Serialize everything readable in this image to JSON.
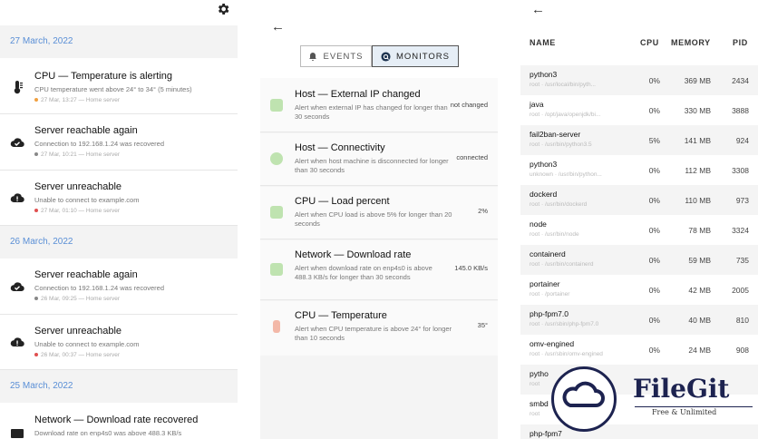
{
  "events_panel": {
    "groups": [
      {
        "date": "27 March, 2022",
        "events": [
          {
            "title": "CPU — Temperature is alerting",
            "desc": "CPU temperature went above 24° to 34° (5 minutes)",
            "meta": "27 Mar, 13:27 — Home server",
            "icon": "thermometer-icon",
            "status_color": "#f0a040"
          },
          {
            "title": "Server reachable again",
            "desc": "Connection to 192.168.1.24 was recovered",
            "meta": "27 Mar, 10:21 — Home server",
            "icon": "cloud-check-icon",
            "status_color": "#888888"
          },
          {
            "title": "Server unreachable",
            "desc": "Unable to connect to example.com",
            "meta": "27 Mar, 01:10 — Home server",
            "icon": "cloud-alert-icon",
            "status_color": "#e05050"
          }
        ]
      },
      {
        "date": "26 March, 2022",
        "events": [
          {
            "title": "Server reachable again",
            "desc": "Connection to 192.168.1.24 was recovered",
            "meta": "26 Mar, 09:25 — Home server",
            "icon": "cloud-check-icon",
            "status_color": "#888888"
          },
          {
            "title": "Server unreachable",
            "desc": "Unable to connect to example.com",
            "meta": "26 Mar, 00:37 — Home server",
            "icon": "cloud-alert-icon",
            "status_color": "#e05050"
          }
        ]
      },
      {
        "date": "25 March, 2022",
        "events": [
          {
            "title": "Network — Download rate recovered",
            "desc": "Download rate on enp4s0 was above 488.3 KB/s",
            "meta": "",
            "icon": "network-icon",
            "status_color": "#888888"
          }
        ]
      }
    ]
  },
  "monitors_panel": {
    "tabs": [
      {
        "label": "EVENTS",
        "icon": "bell-icon",
        "active": false
      },
      {
        "label": "MONITORS",
        "icon": "monitor-icon",
        "active": true
      }
    ],
    "monitors": [
      {
        "title": "Host — External IP changed",
        "desc": "Alert when external IP has changed for longer than 30 seconds",
        "value": "not changed",
        "icon": "ip-icon",
        "color": "#bfe3b0"
      },
      {
        "title": "Host — Connectivity",
        "desc": "Alert when host machine is disconnected for longer than 30 seconds",
        "value": "connected",
        "icon": "globe-icon",
        "color": "#bfe3b0"
      },
      {
        "title": "CPU — Load percent",
        "desc": "Alert when CPU load is above 5% for longer than 20 seconds",
        "value": "2%",
        "icon": "cpu-icon",
        "color": "#bfe3b0"
      },
      {
        "title": "Network — Download rate",
        "desc": "Alert when download rate on enp4s0 is above 488.3 KB/s for longer than 30 seconds",
        "value": "145.0 KB/s",
        "icon": "network-icon",
        "color": "#bfe3b0"
      },
      {
        "title": "CPU — Temperature",
        "desc": "Alert when CPU temperature is above 24° for longer than 10 seconds",
        "value": "35°",
        "icon": "thermometer-icon",
        "color": "#f3b8a8"
      }
    ]
  },
  "processes_panel": {
    "headers": {
      "name": "NAME",
      "cpu": "CPU",
      "memory": "MEMORY",
      "pid": "PID"
    },
    "rows": [
      {
        "name": "python3",
        "cmd": "root · /usr/local/bin/pyth...",
        "cpu": "0%",
        "memory": "369 MB",
        "pid": "2434"
      },
      {
        "name": "java",
        "cmd": "root · /opt/java/openjdk/bi...",
        "cpu": "0%",
        "memory": "330 MB",
        "pid": "3888"
      },
      {
        "name": "fail2ban-server",
        "cmd": "root · /usr/bin/python3.5",
        "cpu": "5%",
        "memory": "141 MB",
        "pid": "924"
      },
      {
        "name": "python3",
        "cmd": "unknown · /usr/bin/python...",
        "cpu": "0%",
        "memory": "112 MB",
        "pid": "3308"
      },
      {
        "name": "dockerd",
        "cmd": "root · /usr/bin/dockerd",
        "cpu": "0%",
        "memory": "110 MB",
        "pid": "973"
      },
      {
        "name": "node",
        "cmd": "root · /usr/bin/node",
        "cpu": "0%",
        "memory": "78 MB",
        "pid": "3324"
      },
      {
        "name": "containerd",
        "cmd": "root · /usr/bin/containerd",
        "cpu": "0%",
        "memory": "59 MB",
        "pid": "735"
      },
      {
        "name": "portainer",
        "cmd": "root · /portainer",
        "cpu": "0%",
        "memory": "42 MB",
        "pid": "2005"
      },
      {
        "name": "php-fpm7.0",
        "cmd": "root · /usr/sbin/php-fpm7.0",
        "cpu": "0%",
        "memory": "40 MB",
        "pid": "810"
      },
      {
        "name": "omv-engined",
        "cmd": "root · /usr/sbin/omv-engined",
        "cpu": "0%",
        "memory": "24 MB",
        "pid": "908"
      },
      {
        "name": "pytho",
        "cmd": "root",
        "cpu": "",
        "memory": "",
        "pid": ""
      },
      {
        "name": "smbd",
        "cmd": "root",
        "cpu": "",
        "memory": "",
        "pid": ""
      },
      {
        "name": "php-fpm7",
        "cmd": "",
        "cpu": "",
        "memory": "",
        "pid": ""
      }
    ]
  },
  "watermark": {
    "brand": "FileGit",
    "tagline": "Free & Unlimited"
  }
}
